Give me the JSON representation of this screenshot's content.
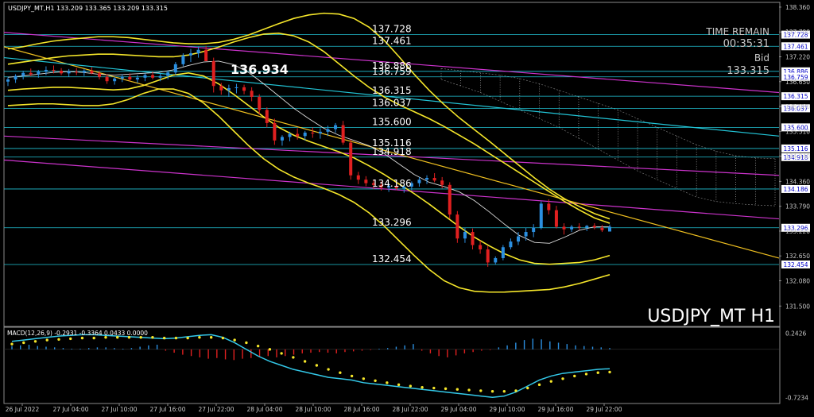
{
  "chart_data": [
    {
      "type": "candlestick",
      "symbol_header": "USDJPY_MT,H1  133.209 133.365 133.209 133.315",
      "watermark": "USDJPY_MT H1",
      "info": {
        "time_remain_label": "TIME REMAIN",
        "time_remain": "00:35:31",
        "bid_label": "Bid",
        "bid": "133.315"
      },
      "ylim": [
        131.05,
        138.45
      ],
      "y_ticks": [
        "138.360",
        "137.790",
        "137.220",
        "136.650",
        "136.080",
        "135.510",
        "134.940",
        "134.360",
        "133.790",
        "133.220",
        "132.650",
        "132.080",
        "131.500"
      ],
      "x_ticks": [
        "26 Jul 2022",
        "27 Jul 04:00",
        "27 Jul 10:00",
        "27 Jul 16:00",
        "27 Jul 22:00",
        "28 Jul 04:00",
        "28 Jul 10:00",
        "28 Jul 16:00",
        "28 Jul 22:00",
        "29 Jul 04:00",
        "29 Jul 10:00",
        "29 Jul 16:00",
        "29 Jul 22:00"
      ],
      "levels": [
        {
          "value": 137.728,
          "label": "137.728"
        },
        {
          "value": 137.461,
          "label": "137.461"
        },
        {
          "value": 136.886,
          "label": "136.886"
        },
        {
          "value": 136.759,
          "label": "136.759"
        },
        {
          "value": 136.315,
          "label": "136.315"
        },
        {
          "value": 136.037,
          "label": "136.037"
        },
        {
          "value": 135.6,
          "label": "135.600"
        },
        {
          "value": 135.116,
          "label": "135.116"
        },
        {
          "value": 134.918,
          "label": "134.918"
        },
        {
          "value": 134.186,
          "label": "134.186"
        },
        {
          "value": 133.296,
          "label": "133.296"
        },
        {
          "value": 132.454,
          "label": "132.454"
        }
      ],
      "highlight_label": {
        "value": 136.934,
        "label": "136.934"
      },
      "candles": [
        [
          136.65,
          136.75,
          136.55,
          136.7
        ],
        [
          136.7,
          136.82,
          136.62,
          136.78
        ],
        [
          136.78,
          136.9,
          136.7,
          136.85
        ],
        [
          136.85,
          136.95,
          136.78,
          136.82
        ],
        [
          136.82,
          136.92,
          136.74,
          136.88
        ],
        [
          136.88,
          137.0,
          136.8,
          136.92
        ],
        [
          136.92,
          137.02,
          136.84,
          136.9
        ],
        [
          136.9,
          136.96,
          136.8,
          136.84
        ],
        [
          136.84,
          136.94,
          136.76,
          136.88
        ],
        [
          136.88,
          136.96,
          136.8,
          136.86
        ],
        [
          136.86,
          136.94,
          136.78,
          136.9
        ],
        [
          136.9,
          136.98,
          136.82,
          136.84
        ],
        [
          136.84,
          136.9,
          136.7,
          136.76
        ],
        [
          136.76,
          136.82,
          136.6,
          136.66
        ],
        [
          136.66,
          136.76,
          136.58,
          136.72
        ],
        [
          136.72,
          136.82,
          136.64,
          136.76
        ],
        [
          136.76,
          136.84,
          136.66,
          136.7
        ],
        [
          136.7,
          136.8,
          136.62,
          136.74
        ],
        [
          136.74,
          136.84,
          136.66,
          136.8
        ],
        [
          136.8,
          136.88,
          136.7,
          136.74
        ],
        [
          136.74,
          136.84,
          136.66,
          136.78
        ],
        [
          136.78,
          136.9,
          136.7,
          136.86
        ],
        [
          136.86,
          137.1,
          136.8,
          137.05
        ],
        [
          137.05,
          137.3,
          137.0,
          137.25
        ],
        [
          137.25,
          137.4,
          137.1,
          137.3
        ],
        [
          137.3,
          137.45,
          137.2,
          137.38
        ],
        [
          137.38,
          137.47,
          137.25,
          137.12
        ],
        [
          137.12,
          137.2,
          136.4,
          136.55
        ],
        [
          136.55,
          136.62,
          136.35,
          136.45
        ],
        [
          136.45,
          136.58,
          136.3,
          136.5
        ],
        [
          136.5,
          136.6,
          136.38,
          136.52
        ],
        [
          136.52,
          136.58,
          136.36,
          136.44
        ],
        [
          136.44,
          136.52,
          136.2,
          136.3
        ],
        [
          136.3,
          136.36,
          135.9,
          136.0
        ],
        [
          136.0,
          136.06,
          135.6,
          135.7
        ],
        [
          135.7,
          135.8,
          135.2,
          135.3
        ],
        [
          135.3,
          135.42,
          135.18,
          135.38
        ],
        [
          135.38,
          135.5,
          135.28,
          135.45
        ],
        [
          135.45,
          135.58,
          135.32,
          135.4
        ],
        [
          135.4,
          135.52,
          135.3,
          135.48
        ],
        [
          135.48,
          135.6,
          135.36,
          135.46
        ],
        [
          135.46,
          135.58,
          135.34,
          135.5
        ],
        [
          135.5,
          135.64,
          135.4,
          135.56
        ],
        [
          135.56,
          135.7,
          135.48,
          135.65
        ],
        [
          135.65,
          135.75,
          135.2,
          135.25
        ],
        [
          135.25,
          135.32,
          134.4,
          134.5
        ],
        [
          134.5,
          134.58,
          134.3,
          134.4
        ],
        [
          134.4,
          134.48,
          134.25,
          134.32
        ],
        [
          134.32,
          134.4,
          134.18,
          134.28
        ],
        [
          134.28,
          134.36,
          134.15,
          134.22
        ],
        [
          134.22,
          134.32,
          134.12,
          134.26
        ],
        [
          134.26,
          134.36,
          134.16,
          134.2
        ],
        [
          134.2,
          134.3,
          134.1,
          134.24
        ],
        [
          134.24,
          134.36,
          134.16,
          134.32
        ],
        [
          134.32,
          134.46,
          134.24,
          134.4
        ],
        [
          134.4,
          134.5,
          134.3,
          134.44
        ],
        [
          134.44,
          134.55,
          134.34,
          134.38
        ],
        [
          134.38,
          134.46,
          134.2,
          134.28
        ],
        [
          134.28,
          134.34,
          133.5,
          133.6
        ],
        [
          133.6,
          133.68,
          132.95,
          133.05
        ],
        [
          133.05,
          133.3,
          132.95,
          133.2
        ],
        [
          133.2,
          133.28,
          132.8,
          132.9
        ],
        [
          132.9,
          133.0,
          132.7,
          132.8
        ],
        [
          132.8,
          132.88,
          132.4,
          132.5
        ],
        [
          132.5,
          132.64,
          132.45,
          132.6
        ],
        [
          132.6,
          132.9,
          132.55,
          132.85
        ],
        [
          132.85,
          133.05,
          132.8,
          132.98
        ],
        [
          132.98,
          133.2,
          132.9,
          133.1
        ],
        [
          133.1,
          133.3,
          133.0,
          133.2
        ],
        [
          133.2,
          133.38,
          133.08,
          133.3
        ],
        [
          133.3,
          133.9,
          133.26,
          133.85
        ],
        [
          133.85,
          133.95,
          133.6,
          133.7
        ],
        [
          133.7,
          133.8,
          133.28,
          133.32
        ],
        [
          133.32,
          133.4,
          133.14,
          133.26
        ],
        [
          133.26,
          133.36,
          133.2,
          133.32
        ],
        [
          133.32,
          133.4,
          133.24,
          133.3
        ],
        [
          133.3,
          133.36,
          133.22,
          133.34
        ],
        [
          133.34,
          133.4,
          133.26,
          133.3
        ],
        [
          133.3,
          133.36,
          133.2,
          133.24
        ],
        [
          133.21,
          133.37,
          133.21,
          133.32
        ]
      ],
      "bands": [
        {
          "name": "outer-upper",
          "color": "#f5e62a",
          "values": [
            137.4,
            137.45,
            137.52,
            137.58,
            137.62,
            137.65,
            137.68,
            137.68,
            137.66,
            137.62,
            137.58,
            137.54,
            137.52,
            137.52,
            137.55,
            137.62,
            137.72,
            137.85,
            137.98,
            138.1,
            138.18,
            138.22,
            138.2,
            138.1,
            137.9,
            137.6,
            137.22,
            136.82,
            136.45,
            136.12,
            135.82,
            135.55,
            135.28,
            135.0,
            134.72,
            134.44,
            134.18,
            133.96,
            133.78,
            133.62,
            133.5
          ]
        },
        {
          "name": "mid-upper",
          "color": "#f5e62a",
          "values": [
            137.05,
            137.1,
            137.15,
            137.2,
            137.24,
            137.26,
            137.28,
            137.28,
            137.26,
            137.24,
            137.22,
            137.22,
            137.26,
            137.34,
            137.44,
            137.56,
            137.66,
            137.74,
            137.76,
            137.7,
            137.56,
            137.34,
            137.06,
            136.78,
            136.52,
            136.3,
            136.12,
            135.96,
            135.8,
            135.62,
            135.42,
            135.22,
            135.0,
            134.78,
            134.56,
            134.34,
            134.12,
            133.9,
            133.7,
            133.52,
            133.4
          ]
        },
        {
          "name": "mid-lower",
          "color": "#f5e62a",
          "values": [
            136.45,
            136.48,
            136.5,
            136.52,
            136.52,
            136.5,
            136.48,
            136.46,
            136.48,
            136.56,
            136.68,
            136.8,
            136.85,
            136.78,
            136.6,
            136.36,
            136.1,
            135.84,
            135.6,
            135.42,
            135.28,
            135.16,
            135.04,
            134.9,
            134.72,
            134.52,
            134.3,
            134.08,
            133.84,
            133.58,
            133.32,
            133.08,
            132.88,
            132.7,
            132.56,
            132.48,
            132.46,
            132.48,
            132.5,
            132.56,
            132.66
          ]
        },
        {
          "name": "outer-lower",
          "color": "#f5e62a",
          "values": [
            136.1,
            136.12,
            136.14,
            136.14,
            136.12,
            136.1,
            136.1,
            136.14,
            136.24,
            136.38,
            136.48,
            136.48,
            136.38,
            136.16,
            135.86,
            135.52,
            135.18,
            134.88,
            134.64,
            134.46,
            134.32,
            134.2,
            134.06,
            133.88,
            133.64,
            133.34,
            133.0,
            132.66,
            132.34,
            132.08,
            131.92,
            131.84,
            131.82,
            131.82,
            131.84,
            131.86,
            131.88,
            131.94,
            132.02,
            132.12,
            132.22
          ]
        }
      ],
      "ma": {
        "name": "moving-average",
        "color": "#dddddd",
        "values": [
          136.75,
          136.78,
          136.82,
          136.86,
          136.88,
          136.86,
          136.82,
          136.8,
          136.82,
          136.84,
          136.86,
          136.92,
          137.02,
          137.1,
          137.12,
          137.04,
          136.86,
          136.6,
          136.32,
          136.04,
          135.8,
          135.58,
          135.42,
          135.3,
          135.18,
          135.0,
          134.76,
          134.52,
          134.34,
          134.24,
          134.12,
          133.92,
          133.66,
          133.38,
          133.12,
          132.96,
          132.94,
          133.08,
          133.24,
          133.32,
          133.32
        ]
      },
      "ichimoku_cloud": {
        "color": "#cccccc",
        "upper": [
          136.95,
          136.9,
          136.85,
          136.8,
          136.72,
          136.6,
          136.45,
          136.3,
          136.15,
          136.0,
          135.8,
          135.6,
          135.4,
          135.2,
          135.05,
          134.95,
          134.9,
          134.88
        ],
        "lower": [
          136.7,
          136.55,
          136.4,
          136.2,
          136.0,
          135.8,
          135.6,
          135.35,
          135.1,
          134.85,
          134.6,
          134.4,
          134.2,
          134.0,
          133.9,
          133.85,
          133.82,
          133.8
        ]
      },
      "trendlines": [
        {
          "name": "magenta-upper",
          "color": "#cc33cc",
          "from": [
            137.78
          ],
          "to": [
            136.4
          ]
        },
        {
          "name": "magenta-mid",
          "color": "#cc33cc",
          "from": [
            135.4
          ],
          "to": [
            134.5
          ]
        },
        {
          "name": "magenta-lower",
          "color": "#cc33cc",
          "from": [
            134.85
          ],
          "to": [
            133.5
          ]
        },
        {
          "name": "orange-down",
          "color": "#f0c020",
          "from": [
            137.45
          ],
          "to": [
            132.6
          ]
        },
        {
          "name": "cyan-line",
          "color": "#22c4d6",
          "from": [
            137.2
          ],
          "to": [
            135.4
          ]
        }
      ]
    },
    {
      "type": "macd",
      "label": "MACD(12,26,9) -0.2931 -0.3364 0.0433 0.0000",
      "ylim": [
        -0.8,
        0.32
      ],
      "y_ticks": [
        "0.2426",
        "-0.7234"
      ],
      "histogram": [
        0.05,
        0.06,
        0.07,
        0.05,
        0.04,
        0.03,
        0.02,
        0.01,
        0.01,
        0.02,
        0.03,
        0.03,
        0.02,
        0.01,
        0.02,
        0.04,
        0.06,
        0.07,
        -0.02,
        -0.05,
        -0.08,
        -0.1,
        -0.12,
        -0.14,
        -0.13,
        -0.15,
        -0.16,
        -0.14,
        -0.13,
        -0.12,
        -0.1,
        -0.12,
        -0.1,
        -0.08,
        -0.06,
        -0.05,
        -0.04,
        -0.05,
        -0.06,
        -0.04,
        -0.03,
        -0.02,
        -0.01,
        0.01,
        0.02,
        0.04,
        0.06,
        0.08,
        -0.02,
        -0.06,
        -0.1,
        -0.12,
        -0.09,
        -0.06,
        -0.04,
        -0.02,
        -0.01,
        0.03,
        0.06,
        0.1,
        0.14,
        0.16,
        0.15,
        0.12,
        0.1,
        0.08,
        0.06,
        0.05,
        0.04,
        0.03,
        0.02
      ],
      "macd_line": [
        0.12,
        0.14,
        0.16,
        0.18,
        0.2,
        0.21,
        0.22,
        0.22,
        0.21,
        0.2,
        0.19,
        0.18,
        0.17,
        0.16,
        0.17,
        0.19,
        0.21,
        0.22,
        0.18,
        0.1,
        0.0,
        -0.1,
        -0.18,
        -0.24,
        -0.3,
        -0.34,
        -0.38,
        -0.42,
        -0.44,
        -0.46,
        -0.5,
        -0.52,
        -0.54,
        -0.56,
        -0.58,
        -0.6,
        -0.62,
        -0.64,
        -0.66,
        -0.68,
        -0.7,
        -0.72,
        -0.7,
        -0.64,
        -0.55,
        -0.46,
        -0.4,
        -0.36,
        -0.34,
        -0.32,
        -0.3,
        -0.29
      ],
      "signal_line": [
        0.08,
        0.1,
        0.12,
        0.14,
        0.15,
        0.16,
        0.17,
        0.17,
        0.18,
        0.18,
        0.18,
        0.18,
        0.18,
        0.17,
        0.17,
        0.17,
        0.18,
        0.18,
        0.17,
        0.14,
        0.1,
        0.05,
        0.0,
        -0.06,
        -0.12,
        -0.18,
        -0.24,
        -0.3,
        -0.35,
        -0.4,
        -0.44,
        -0.47,
        -0.5,
        -0.53,
        -0.55,
        -0.57,
        -0.58,
        -0.59,
        -0.6,
        -0.61,
        -0.62,
        -0.63,
        -0.63,
        -0.62,
        -0.58,
        -0.53,
        -0.48,
        -0.44,
        -0.4,
        -0.37,
        -0.35,
        -0.34
      ]
    }
  ],
  "colors": {
    "bull": "#2b8fe0",
    "bear": "#e02020",
    "level": "#22c4d6",
    "text": "#ffffff",
    "tick": "#c8c8c8",
    "border": "#8a8a8a",
    "label_box_fill": "#ffffff",
    "label_box_text": "#0000c8"
  }
}
